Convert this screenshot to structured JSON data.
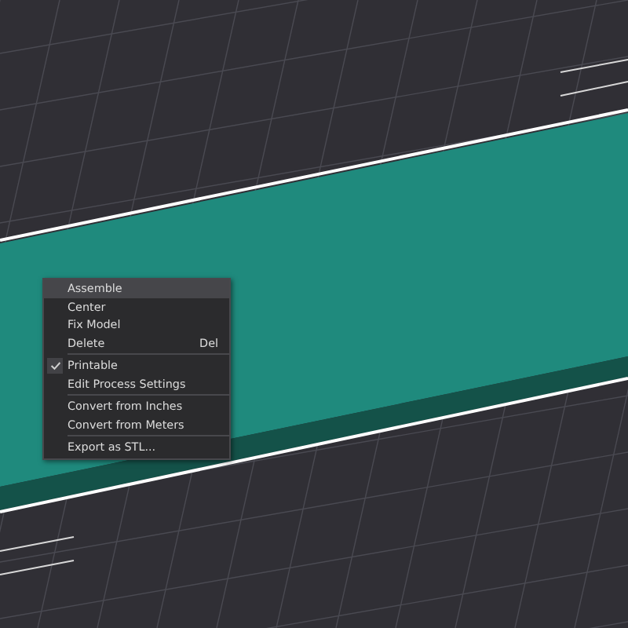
{
  "context_menu": {
    "items": [
      {
        "kind": "item",
        "label": "Assemble",
        "selected": true,
        "checked": false
      },
      {
        "kind": "item",
        "label": "Center",
        "selected": false,
        "checked": false
      },
      {
        "kind": "item",
        "label": "Fix Model",
        "selected": false,
        "checked": false
      },
      {
        "kind": "item",
        "label": "Delete",
        "shortcut": "Del",
        "selected": false,
        "checked": false
      },
      {
        "kind": "separator"
      },
      {
        "kind": "item",
        "label": "Printable",
        "selected": false,
        "checked": true
      },
      {
        "kind": "item",
        "label": "Edit Process Settings",
        "selected": false,
        "checked": false
      },
      {
        "kind": "separator"
      },
      {
        "kind": "item",
        "label": "Convert from Inches",
        "selected": false,
        "checked": false
      },
      {
        "kind": "item",
        "label": "Convert from Meters",
        "selected": false,
        "checked": false
      },
      {
        "kind": "separator"
      },
      {
        "kind": "item",
        "label": "Export as STL...",
        "selected": false,
        "checked": false
      }
    ]
  }
}
